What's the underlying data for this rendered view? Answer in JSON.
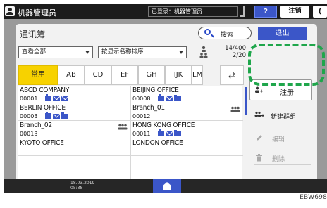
{
  "topbar": {
    "app_title": "机器管理员",
    "login_status": "已登录：机器管理员",
    "help_label": "?",
    "logout_label": "注销",
    "more_label": "("
  },
  "panel": {
    "title": "通讯簿",
    "search_label": "搜索",
    "exit_label": "退出",
    "filter_value": "查看全部",
    "sort_value": "按显示名称排序",
    "count": "14/400",
    "page": "2/20"
  },
  "tabs": [
    {
      "label": "常用",
      "active": true
    },
    {
      "label": "AB"
    },
    {
      "label": "CD"
    },
    {
      "label": "EF"
    },
    {
      "label": "GH"
    },
    {
      "label": "IJK"
    },
    {
      "label": "LM"
    }
  ],
  "entries": [
    {
      "name": "ABCD COMPANY",
      "number": "00001",
      "icons": [
        "fax-icon",
        "mail-icon",
        "mail-icon"
      ],
      "group": false
    },
    {
      "name": "BEIJING OFFICE",
      "number": "00008",
      "icons": [
        "fax-icon",
        "mail-icon",
        "folder-icon"
      ],
      "group": false
    },
    {
      "name": "BERLIN OFFICE",
      "number": "00003",
      "icons": [
        "fax-icon",
        "mail-icon",
        "folder-icon"
      ],
      "group": false
    },
    {
      "name": "Branch_01",
      "number": "00012",
      "icons": [],
      "group": true
    },
    {
      "name": "Branch_02",
      "number": "00013",
      "icons": [],
      "group": true
    },
    {
      "name": "HONG KONG OFFICE",
      "number": "00011",
      "icons": [
        "fax-icon",
        "mail-icon",
        "folder-icon"
      ],
      "group": false
    },
    {
      "name": "KYOTO OFFICE",
      "number": "",
      "icons": [],
      "group": false
    },
    {
      "name": "LONDON OFFICE",
      "number": "",
      "icons": [],
      "group": false
    }
  ],
  "actions": {
    "register": "注册",
    "new_group": "新建群组",
    "edit": "编辑",
    "delete": "删除"
  },
  "bottombar": {
    "date": "18.03.2019",
    "time": "05:38"
  },
  "image_code": "EBW698",
  "colors": {
    "accent_blue": "#3b56c8",
    "tab_active": "#f7d200",
    "highlight_green": "#1fa64b"
  }
}
